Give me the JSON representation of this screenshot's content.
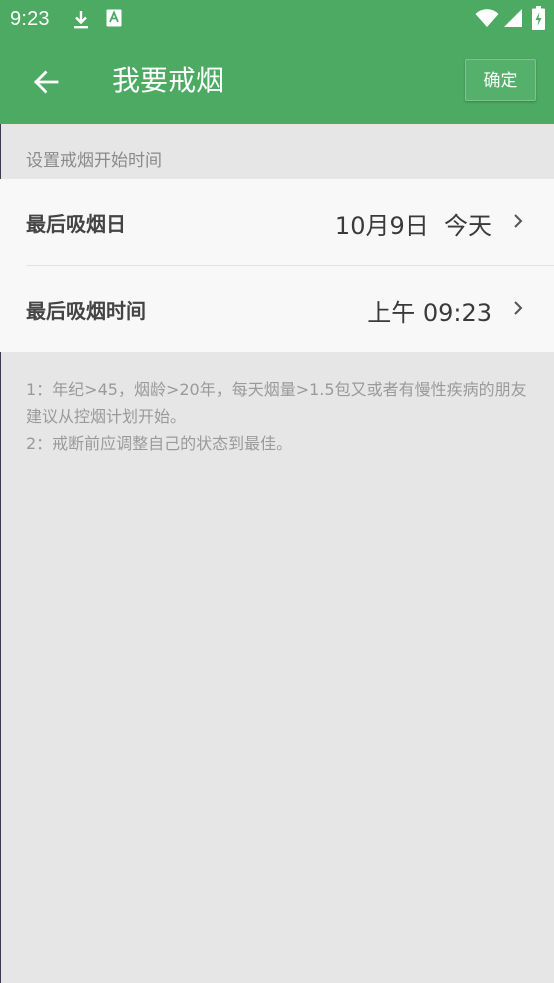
{
  "status_bar": {
    "time": "9:23",
    "icons": [
      "download-icon",
      "font-icon",
      "wifi-icon",
      "signal-icon",
      "battery-icon"
    ]
  },
  "app_bar": {
    "back_icon": "arrow-left-icon",
    "title": "我要戒烟",
    "confirm_label": "确定"
  },
  "section": {
    "header": "设置戒烟开始时间"
  },
  "rows": [
    {
      "label": "最后吸烟日",
      "value": "10月9日  今天"
    },
    {
      "label": "最后吸烟时间",
      "value": "上午 09:23"
    }
  ],
  "notes": {
    "line1": "1：年纪>45，烟龄>20年，每天烟量>1.5包又或者有慢性疾病的朋友建议从控烟计划开始。",
    "line2": "2：戒断前应调整自己的状态到最佳。"
  },
  "colors": {
    "primary": "#4caa62",
    "background": "#e6e6e6",
    "card": "#f8f8f8"
  }
}
